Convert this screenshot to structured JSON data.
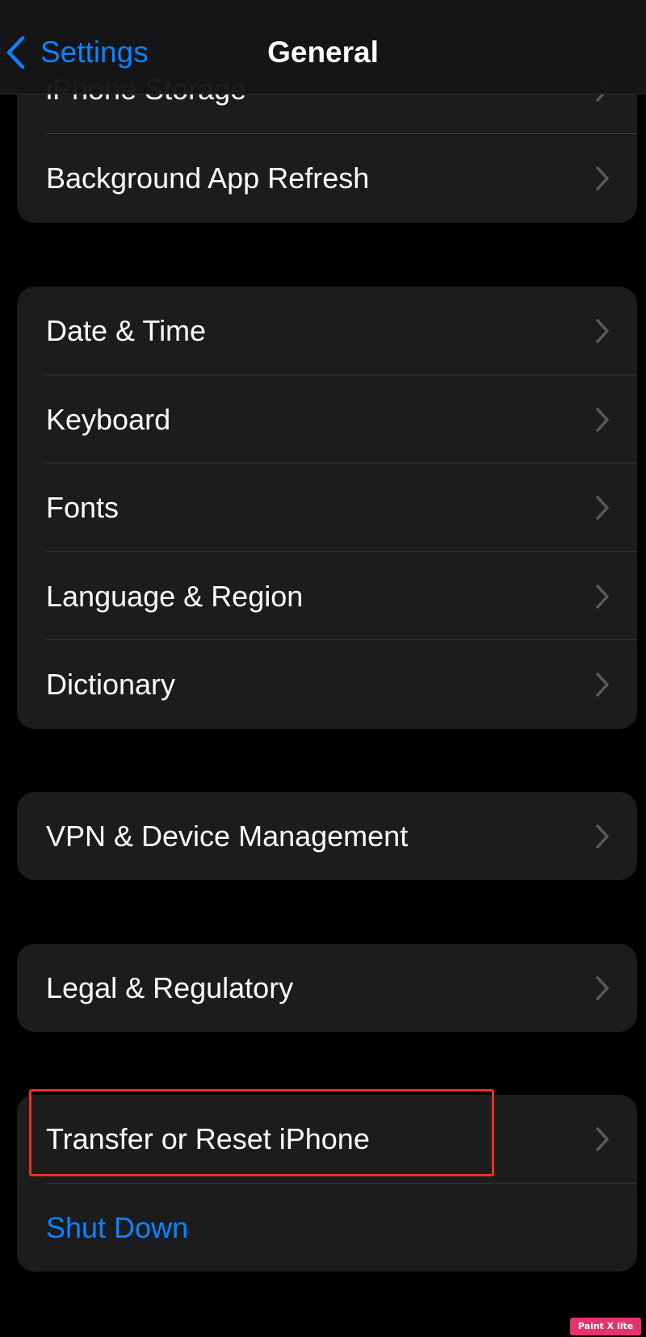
{
  "navbar": {
    "back_label": "Settings",
    "title": "General"
  },
  "groups": [
    {
      "rows": [
        {
          "label": "iPhone Storage",
          "style": "normal"
        },
        {
          "label": "Background App Refresh",
          "style": "normal"
        }
      ]
    },
    {
      "rows": [
        {
          "label": "Date & Time",
          "style": "normal"
        },
        {
          "label": "Keyboard",
          "style": "normal"
        },
        {
          "label": "Fonts",
          "style": "normal"
        },
        {
          "label": "Language & Region",
          "style": "normal"
        },
        {
          "label": "Dictionary",
          "style": "normal"
        }
      ]
    },
    {
      "rows": [
        {
          "label": "VPN & Device Management",
          "style": "normal"
        }
      ]
    },
    {
      "rows": [
        {
          "label": "Legal & Regulatory",
          "style": "normal"
        }
      ]
    },
    {
      "rows": [
        {
          "label": "Transfer or Reset iPhone",
          "style": "normal",
          "highlighted": true
        },
        {
          "label": "Shut Down",
          "style": "action"
        }
      ]
    }
  ],
  "annotation": {
    "highlight_color": "#e8321e"
  },
  "watermark": {
    "text": "Paint X lite"
  },
  "colors": {
    "background": "#000000",
    "cell": "#1c1c1e",
    "accent": "#0a84ff",
    "separator": "#38383a",
    "chevron": "#5a5a5f"
  }
}
